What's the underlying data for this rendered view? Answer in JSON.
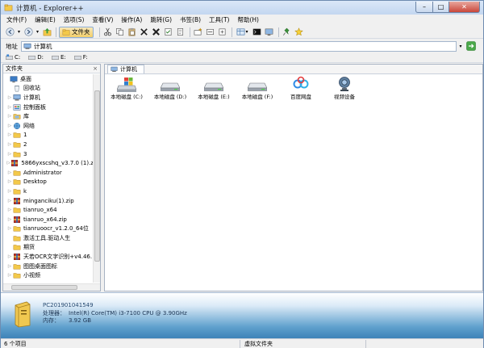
{
  "window": {
    "title": "计算机 - Explorer++"
  },
  "menu": [
    "文件(F)",
    "编辑(E)",
    "选项(S)",
    "查看(V)",
    "操作(A)",
    "跳转(G)",
    "书签(B)",
    "工具(T)",
    "帮助(H)"
  ],
  "toolbar": {
    "folders_label": "文件夹"
  },
  "address": {
    "label": "地址",
    "value": "计算机"
  },
  "drives": [
    "C:",
    "D:",
    "E:",
    "F:"
  ],
  "tree": {
    "header": "文件夹",
    "close": "×",
    "items": [
      {
        "label": "桌面",
        "icon": "desktop-icon",
        "expandable": false
      },
      {
        "label": "回收站",
        "icon": "recycle-bin-icon",
        "expandable": false
      },
      {
        "label": "计算机",
        "icon": "computer-icon",
        "expandable": true
      },
      {
        "label": "控制面板",
        "icon": "control-panel-icon",
        "expandable": true
      },
      {
        "label": "库",
        "icon": "library-icon",
        "expandable": true
      },
      {
        "label": "网络",
        "icon": "network-icon",
        "expandable": true
      },
      {
        "label": "1",
        "icon": "folder-icon",
        "expandable": true
      },
      {
        "label": "2",
        "icon": "folder-icon",
        "expandable": true
      },
      {
        "label": "3",
        "icon": "folder-icon",
        "expandable": true
      },
      {
        "label": "5866yxscshq_v3.7.0 (1).z",
        "icon": "archive-icon",
        "expandable": true
      },
      {
        "label": "Administrator",
        "icon": "folder-icon",
        "expandable": true
      },
      {
        "label": "Desktop",
        "icon": "folder-icon",
        "expandable": true
      },
      {
        "label": "k",
        "icon": "folder-icon",
        "expandable": true
      },
      {
        "label": "minganciku(1).zip",
        "icon": "archive-icon",
        "expandable": true
      },
      {
        "label": "tianruo_x64",
        "icon": "folder-icon",
        "expandable": true
      },
      {
        "label": "tianruo_x64.zip",
        "icon": "archive-icon",
        "expandable": true
      },
      {
        "label": "tianruoocr_v1.2.0_64位",
        "icon": "folder-icon",
        "expandable": true
      },
      {
        "label": "激活工具.驱动人生",
        "icon": "folder-icon",
        "expandable": false
      },
      {
        "label": "期货",
        "icon": "folder-icon",
        "expandable": false
      },
      {
        "label": "天若OCR文字识别+v4.46.",
        "icon": "archive-icon",
        "expandable": true
      },
      {
        "label": "图图桌面图标",
        "icon": "folder-icon",
        "expandable": true
      },
      {
        "label": "小视频",
        "icon": "folder-icon",
        "expandable": true
      }
    ]
  },
  "tab": {
    "label": "计算机"
  },
  "items": [
    {
      "label": "本地磁盘 (C:)",
      "icon": "system-drive-icon"
    },
    {
      "label": "本地磁盘 (D:)",
      "icon": "hard-drive-icon"
    },
    {
      "label": "本地磁盘 (E:)",
      "icon": "hard-drive-icon"
    },
    {
      "label": "本地磁盘 (F:)",
      "icon": "hard-drive-icon"
    },
    {
      "label": "百度网盘",
      "icon": "baidu-netdisk-icon"
    },
    {
      "label": "视频设备",
      "icon": "webcam-icon"
    }
  ],
  "details": {
    "name": "PC201901041549",
    "processor_label": "处理器：",
    "processor": "Intel(R) Core(TM) i3-7100 CPU @ 3.90GHz",
    "memory_label": "内存：",
    "memory": "3.92 GB"
  },
  "status": {
    "count": "6 个项目",
    "location": "虚拟文件夹"
  },
  "colors": {
    "accent": "#3e83b8",
    "folder": "#f3c94a",
    "selection": "#cce8ff"
  }
}
